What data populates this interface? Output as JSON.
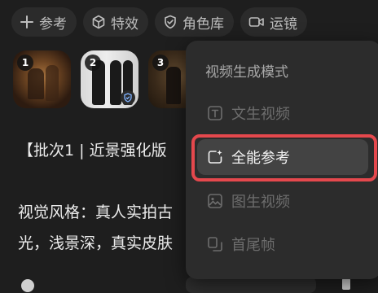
{
  "toolbar": {
    "reference": "参考",
    "effects": "特效",
    "characters": "角色库",
    "camera": "运镜"
  },
  "thumbnails": [
    {
      "index": "1"
    },
    {
      "index": "2"
    },
    {
      "index": "3"
    }
  ],
  "content": {
    "line1": "【批次1 | 近景强化版",
    "line2": "视觉风格：真人实拍古",
    "line3": "光，浅景深，真实皮肤"
  },
  "dropdown": {
    "title": "视频生成模式",
    "items": [
      {
        "label": "文生视频",
        "state": "disabled"
      },
      {
        "label": "全能参考",
        "state": "selected"
      },
      {
        "label": "图生视频",
        "state": "disabled"
      },
      {
        "label": "首尾帧",
        "state": "disabled"
      }
    ]
  },
  "colors": {
    "background": "#1e1e1e",
    "chip": "#2b2b2b",
    "dropdown": "#2c2c2c",
    "selected_item": "#434343",
    "highlight": "#e5484d"
  }
}
